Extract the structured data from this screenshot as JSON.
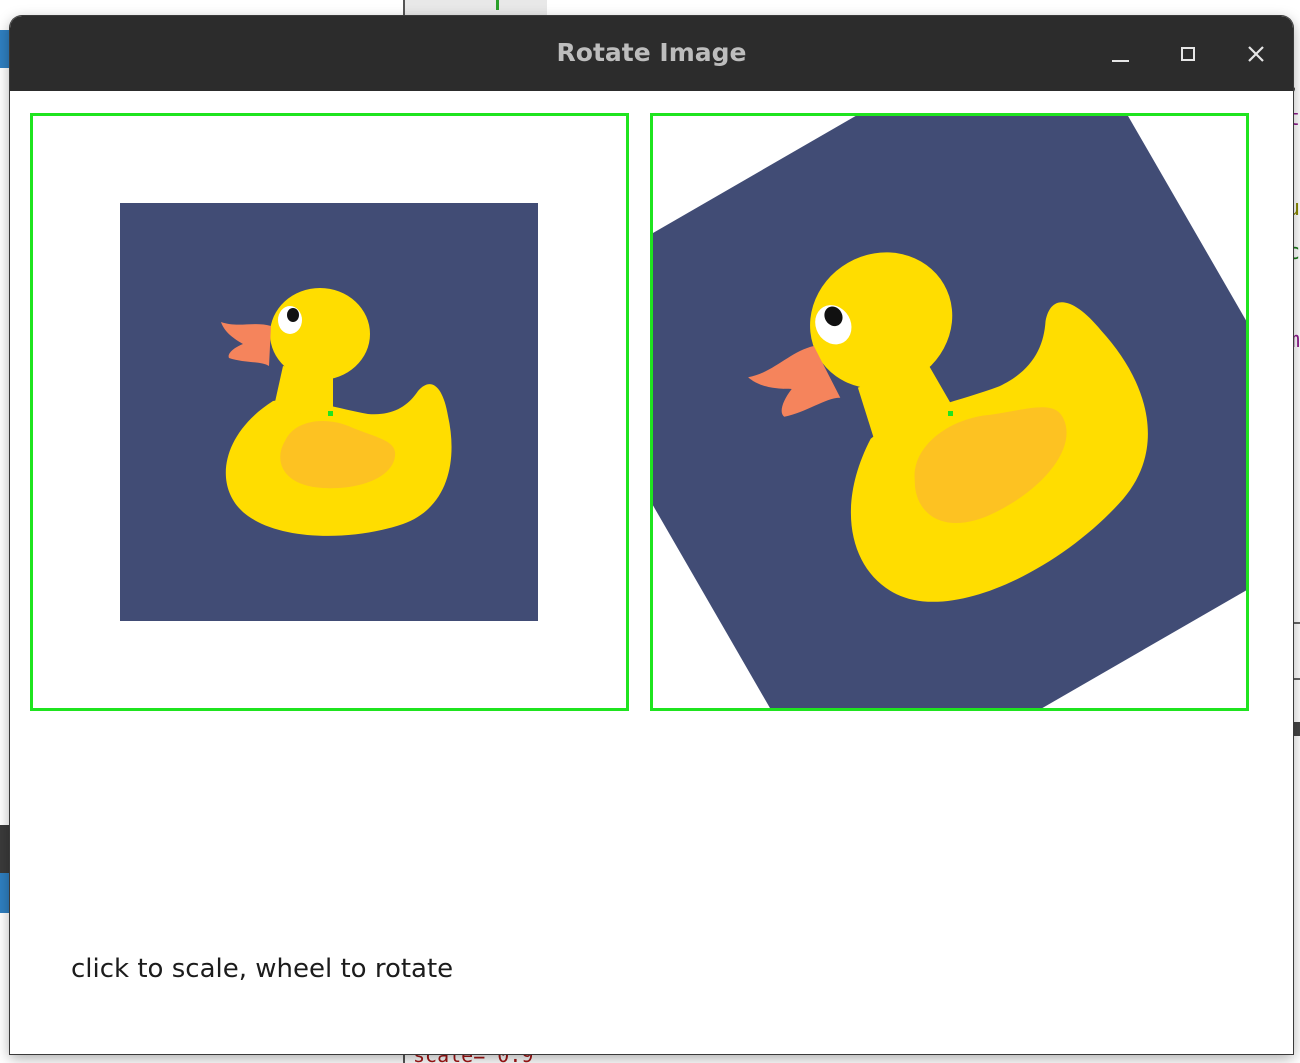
{
  "window": {
    "title": "Rotate Image"
  },
  "panels": {
    "left": {
      "label": "original-image",
      "rotation_deg": 0
    },
    "right": {
      "label": "rotated-image",
      "rotation_deg": 30
    }
  },
  "caption": "click to scale, wheel to rotate",
  "colors": {
    "frame_border": "#1fe41f",
    "image_background": "#414c75",
    "duck_body": "#ffdd00",
    "duck_wing": "#fdc222",
    "duck_beak": "#f5845c",
    "titlebar": "#2c2c2c"
  },
  "background_editor": {
    "bottom_code": "scale= 0.9",
    "right_glyphs": [
      ",",
      "t",
      "u",
      "c",
      "m"
    ]
  }
}
